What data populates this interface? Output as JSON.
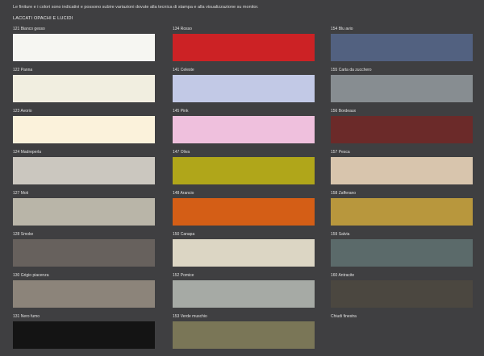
{
  "header": {
    "note": "Le finiture e i colori sono indicativi e possono subire variazioni dovute alla tecnica di stampa e alla visualizzazione su monitor.",
    "section_title": "LACCATI OPACHI E LUCIDI"
  },
  "columns": [
    [
      {
        "label": "121 Bianco gesso",
        "color": "#f6f6f2"
      },
      {
        "label": "122 Panna",
        "color": "#f1eee0"
      },
      {
        "label": "123 Avorio",
        "color": "#fbf2db"
      },
      {
        "label": "124 Madreperla",
        "color": "#cbc7bf"
      },
      {
        "label": "127 Moti",
        "color": "#b9b5a8"
      },
      {
        "label": "128 Smoke",
        "color": "#67615d"
      },
      {
        "label": "130 Grigio piacenza",
        "color": "#8c847a"
      },
      {
        "label": "131 Nero fumo",
        "color": "#141414"
      }
    ],
    [
      {
        "label": "134 Rosso",
        "color": "#cc2225"
      },
      {
        "label": "141 Celeste",
        "color": "#c2c9e6"
      },
      {
        "label": "145 Pink",
        "color": "#efc0dd"
      },
      {
        "label": "147 Oliva",
        "color": "#b0a61a"
      },
      {
        "label": "148 Arancio",
        "color": "#d45e16"
      },
      {
        "label": "150 Canapa",
        "color": "#dcd6c4"
      },
      {
        "label": "152 Pomice",
        "color": "#a6aaa5"
      },
      {
        "label": "153 Verde muschio",
        "color": "#7a7657"
      }
    ],
    [
      {
        "label": "154 Blu avio",
        "color": "#526180"
      },
      {
        "label": "155 Carta da zucchero",
        "color": "#878d91"
      },
      {
        "label": "156 Bordeaux",
        "color": "#6b2a29"
      },
      {
        "label": "157 Pesca",
        "color": "#d8c5ad"
      },
      {
        "label": "158 Zafferano",
        "color": "#b8973d"
      },
      {
        "label": "159 Salvia",
        "color": "#5b6a6a"
      },
      {
        "label": "160 Antracite",
        "color": "#4b4740"
      },
      {
        "label": "Chiudi finestra",
        "color": ""
      }
    ]
  ]
}
